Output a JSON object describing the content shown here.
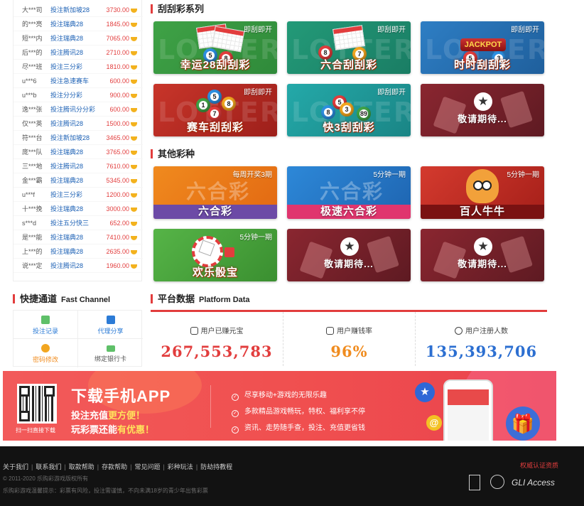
{
  "winners": [
    {
      "user": "大***司",
      "game": "投注新加坡28",
      "amount": "3730.00"
    },
    {
      "user": "的***亮",
      "game": "投注瑞典28",
      "amount": "1845.00"
    },
    {
      "user": "短***内",
      "game": "投注瑞典28",
      "amount": "7065.00"
    },
    {
      "user": "后***的",
      "game": "投注腾讯28",
      "amount": "2710.00"
    },
    {
      "user": "尽***班",
      "game": "投注三分彩",
      "amount": "1810.00"
    },
    {
      "user": "u***6",
      "game": "投注急速赛车",
      "amount": "600.00"
    },
    {
      "user": "u***b",
      "game": "投注分分彩",
      "amount": "900.00"
    },
    {
      "user": "逸***张",
      "game": "投注腾讯分分彩",
      "amount": "600.00"
    },
    {
      "user": "仅***英",
      "game": "投注腾讯28",
      "amount": "1500.00"
    },
    {
      "user": "符***台",
      "game": "投注新加坡28",
      "amount": "3465.00"
    },
    {
      "user": "庞***队",
      "game": "投注瑞典28",
      "amount": "3765.00"
    },
    {
      "user": "三***地",
      "game": "投注腾讯28",
      "amount": "7610.00"
    },
    {
      "user": "金***霸",
      "game": "投注瑞典28",
      "amount": "5345.00"
    },
    {
      "user": "u***f",
      "game": "投注三分彩",
      "amount": "1200.00"
    },
    {
      "user": "十***挽",
      "game": "投注瑞典28",
      "amount": "3000.00"
    },
    {
      "user": "s***d",
      "game": "投注五分快三",
      "amount": "652.00"
    },
    {
      "user": "是***能",
      "game": "投注瑞典28",
      "amount": "7410.00"
    },
    {
      "user": "上***的",
      "game": "投注瑞典28",
      "amount": "2635.00"
    },
    {
      "user": "说***定",
      "game": "投注腾讯28",
      "amount": "1960.00"
    }
  ],
  "scratch_section": {
    "title": "刮刮彩系列"
  },
  "scratch_cards": [
    {
      "name": "幸运28刮刮彩",
      "tag": "即刮即开",
      "watermark": "LOTTERY"
    },
    {
      "name": "六合刮刮彩",
      "tag": "即刮即开",
      "watermark": "LOTTERY"
    },
    {
      "name": "时时刮刮彩",
      "tag": "即刮即开",
      "watermark": "LOTTERY",
      "logo": "JACKPOT"
    },
    {
      "name": "赛车刮刮彩",
      "tag": "即刮即开",
      "watermark": "LOTTERY"
    },
    {
      "name": "快3刮刮彩",
      "tag": "即刮即开",
      "watermark": "LOTTERY"
    },
    {
      "name": "敬请期待...",
      "tag": "",
      "icon": "star-icon"
    }
  ],
  "other_section": {
    "title": "其他彩种"
  },
  "other_cards": [
    {
      "name": "六合彩",
      "tag": "每周开奖3期",
      "watermark": "六合彩"
    },
    {
      "name": "极速六合彩",
      "tag": "5分钟一期",
      "watermark": "六合彩"
    },
    {
      "name": "百人牛牛",
      "tag": "5分钟一期"
    },
    {
      "name": "欢乐骰宝",
      "tag": "5分钟一期"
    },
    {
      "name": "敬请期待...",
      "tag": "",
      "icon": "star-icon"
    },
    {
      "name": "敬请期待...",
      "tag": "",
      "icon": "star-icon"
    }
  ],
  "quick_channel": {
    "title": "快捷通道",
    "title_en": "Fast Channel",
    "items": [
      {
        "label": "投注记录",
        "icon": "record-icon"
      },
      {
        "label": "代理分享",
        "icon": "agent-icon"
      },
      {
        "label": "密码修改",
        "icon": "key-icon"
      },
      {
        "label": "绑定银行卡",
        "icon": "bank-card-icon"
      }
    ]
  },
  "platform_data": {
    "title": "平台数据",
    "title_en": "Platform Data",
    "stats": [
      {
        "label": "用户已赚元宝",
        "value": "267,553,783",
        "color": "#e23d3d"
      },
      {
        "label": "用户赚钱率",
        "value": "96%",
        "color": "#f08c1f"
      },
      {
        "label": "用户注册人数",
        "value": "135,393,706",
        "color": "#2c6fd1"
      }
    ]
  },
  "app_banner": {
    "title": "下载手机APP",
    "line1_a": "投注充值",
    "line1_b": "更方便！",
    "line2_a": "玩彩票还能",
    "line2_b": "有优惠！",
    "qr_caption": "扫一扫直接下载",
    "features": [
      "尽享移动+游戏的无限乐趣",
      "多款精品游戏畅玩，特权、福利享不停",
      "资讯、走势随手查，投注、充值更省钱"
    ]
  },
  "footer": {
    "links": [
      "关于我们",
      "联系我们",
      "取款帮助",
      "存款帮助",
      "常见问题",
      "彩种玩法",
      "防劫持教程"
    ],
    "copyright": "© 2011-2020 乐购彩游戏版权所有",
    "warning": "乐购彩游戏温馨提示：彩票有风险，投注需谨慎，不向未满18岁的青少年出售彩票",
    "auth_label": "权威认证资质",
    "auth_logos": [
      "GLI Access"
    ]
  },
  "colors": {
    "accent": "#e23d3d",
    "link": "#1a5fb4",
    "footer_bg": "#121212"
  }
}
